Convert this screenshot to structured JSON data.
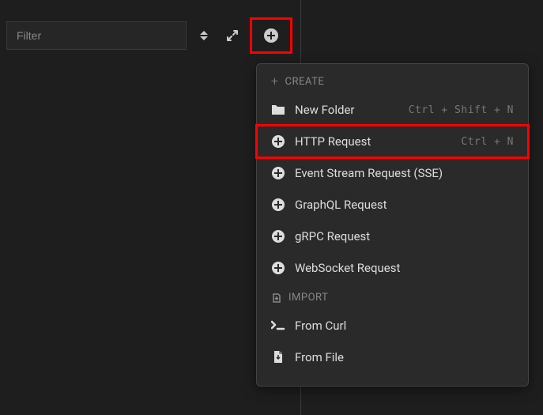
{
  "toolbar": {
    "filter_placeholder": "Filter"
  },
  "menu": {
    "create_header": "CREATE",
    "import_header": "IMPORT",
    "items_create": [
      {
        "label": "New Folder",
        "shortcut": "Ctrl + Shift + N",
        "icon": "folder"
      },
      {
        "label": "HTTP Request",
        "shortcut": "Ctrl + N",
        "icon": "plus",
        "highlighted": true
      },
      {
        "label": "Event Stream Request (SSE)",
        "shortcut": "",
        "icon": "plus"
      },
      {
        "label": "GraphQL Request",
        "shortcut": "",
        "icon": "plus"
      },
      {
        "label": "gRPC Request",
        "shortcut": "",
        "icon": "plus"
      },
      {
        "label": "WebSocket Request",
        "shortcut": "",
        "icon": "plus"
      }
    ],
    "items_import": [
      {
        "label": "From Curl",
        "icon": "curl"
      },
      {
        "label": "From File",
        "icon": "file"
      }
    ]
  }
}
